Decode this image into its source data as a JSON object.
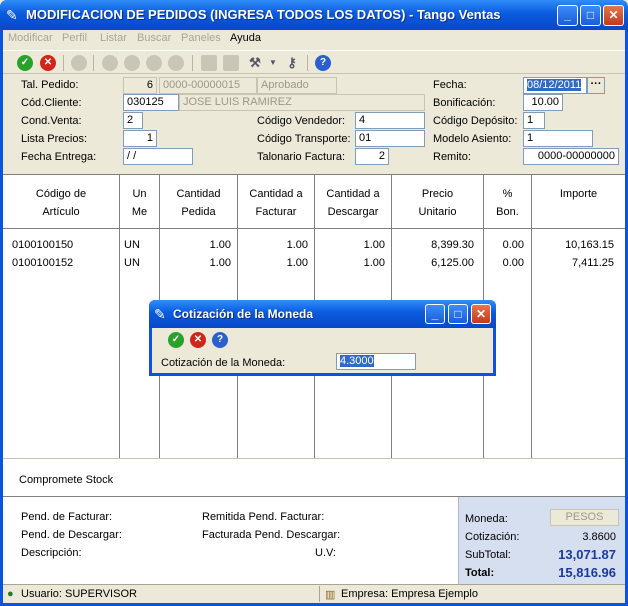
{
  "window": {
    "title": "MODIFICACION DE PEDIDOS (INGRESA TODOS LOS DATOS) - Tango Ventas"
  },
  "menu": [
    "Modificar",
    "Perfil",
    "Listar",
    "Buscar",
    "Paneles",
    "Ayuda"
  ],
  "form": {
    "tal_pedido_label": "Tal. Pedido:",
    "tal_pedido": "6",
    "nro_pedido": "0000-00000015",
    "estado": "Aprobado",
    "cod_cliente_label": "Cód.Cliente:",
    "cod_cliente": "030125",
    "cliente_nombre": "JOSE LUIS RAMIREZ",
    "cond_venta_label": "Cond.Venta:",
    "cond_venta": "2",
    "lista_precios_label": "Lista Precios:",
    "lista_precios": "1",
    "fecha_entrega_label": "Fecha Entrega:",
    "fecha_entrega": "/ /",
    "cod_vendedor_label": "Código Vendedor:",
    "cod_vendedor": "4",
    "cod_transporte_label": "Código Transporte:",
    "cod_transporte": "01",
    "talonario_label": "Talonario Factura:",
    "talonario": "2",
    "fecha_label": "Fecha:",
    "fecha": "08/12/2011",
    "bonificacion_label": "Bonificación:",
    "bonificacion": "10.00",
    "cod_deposito_label": "Código Depósito:",
    "cod_deposito": "1",
    "modelo_asiento_label": "Modelo Asiento:",
    "modelo_asiento": "1",
    "remito_label": "Remito:",
    "remito": "0000-00000000"
  },
  "grid": {
    "headers": [
      {
        "l1": "Código de",
        "l2": "Artículo"
      },
      {
        "l1": "Un",
        "l2": "Me"
      },
      {
        "l1": "Cantidad",
        "l2": "Pedida"
      },
      {
        "l1": "Cantidad a",
        "l2": "Facturar"
      },
      {
        "l1": "Cantidad a",
        "l2": "Descargar"
      },
      {
        "l1": "Precio",
        "l2": "Unitario"
      },
      {
        "l1": "%",
        "l2": "Bon."
      },
      {
        "l1": "Importe",
        "l2": ""
      }
    ],
    "rows": [
      [
        "0100100150",
        "UN",
        "1.00",
        "1.00",
        "1.00",
        "8,399.30",
        "0.00",
        "10,163.15"
      ],
      [
        "0100100152",
        "UN",
        "1.00",
        "1.00",
        "1.00",
        "6,125.00",
        "0.00",
        "7,411.25"
      ]
    ]
  },
  "compromete": "Compromete Stock",
  "bottom": {
    "pend_facturar": "Pend. de Facturar:",
    "pend_descargar": "Pend. de Descargar:",
    "descripcion": "Descripción:",
    "remitida": "Remitida Pend. Facturar:",
    "facturada": "Facturada Pend. Descargar:",
    "uv": "U.V:",
    "moneda_label": "Moneda:",
    "moneda": "PESOS",
    "cotizacion_label": "Cotización:",
    "cotizacion": "3.8600",
    "subtotal_label": "SubTotal:",
    "subtotal": "13,071.87",
    "total_label": "Total:",
    "total": "15,816.96"
  },
  "status": {
    "usuario": "Usuario: SUPERVISOR",
    "empresa": "Empresa: Empresa Ejemplo"
  },
  "dialog": {
    "title": "Cotización de la Moneda",
    "label": "Cotización de la Moneda:",
    "value": "4.3000"
  }
}
